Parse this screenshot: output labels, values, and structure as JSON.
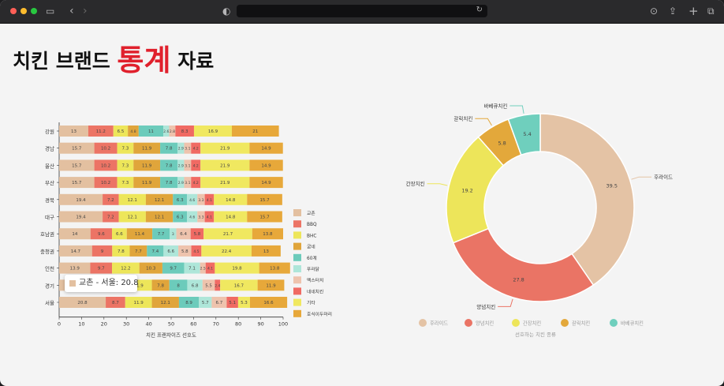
{
  "browser": {
    "url": ""
  },
  "page": {
    "title_a": "치킨 브랜드 ",
    "title_b": "통계",
    "title_c": " 자료"
  },
  "colors": {
    "교촌": "#e3c0a0",
    "BBQ": "#ec7465",
    "BHC": "#ede65a",
    "굽네": "#e0a53b",
    "60계": "#6ccbbb",
    "푸라닭": "#aee6d9",
    "멕스터치": "#eec3ad",
    "네네치킨": "#f06a63",
    "기타": "#f0e860",
    "호식이두마리": "#e7a83a",
    "후라이드": "#e4c3a5",
    "양념치킨": "#ea7465",
    "간장치킨": "#ede55a",
    "갈릭치킨": "#e3a83b",
    "바베큐치킨": "#6fcfbd"
  },
  "chart_data": [
    {
      "type": "bar",
      "orientation": "horizontal-stacked",
      "categories": [
        "강원",
        "경남",
        "울산",
        "부산",
        "경북",
        "대구",
        "호남권",
        "충청권",
        "인천",
        "경기",
        "서울"
      ],
      "series": [
        {
          "name": "교촌",
          "values": [
            13,
            15.7,
            15.7,
            15.7,
            19.4,
            19.4,
            14,
            14.7,
            13.9,
            20.8,
            20.8
          ]
        },
        {
          "name": "BBQ",
          "values": [
            11.2,
            10.2,
            10.2,
            10.2,
            7.2,
            7.2,
            9.6,
            9.0,
            9.7,
            8.7,
            8.7
          ]
        },
        {
          "name": "BHC",
          "values": [
            6.5,
            7.3,
            7.3,
            7.3,
            12.1,
            12.1,
            6.6,
            7.8,
            12.2,
            11.9,
            11.9
          ]
        },
        {
          "name": "굽네",
          "values": [
            4.8,
            11.9,
            11.9,
            11.9,
            12.1,
            12.1,
            11.4,
            7.7,
            10.3,
            7.8,
            12.1
          ]
        },
        {
          "name": "60계",
          "values": [
            11,
            7.8,
            7.8,
            7.8,
            6.3,
            6.3,
            7.7,
            7.4,
            9.7,
            8,
            8.9
          ]
        },
        {
          "name": "푸라닭",
          "values": [
            2.6,
            2.9,
            2.9,
            2.9,
            4.6,
            4.6,
            3,
            6.6,
            7.1,
            6.8,
            5.7
          ]
        },
        {
          "name": "멕스터치",
          "values": [
            2.8,
            3.1,
            3.1,
            3.1,
            3.3,
            3.3,
            6.4,
            5.8,
            2.5,
            5.5,
            6.7
          ]
        },
        {
          "name": "네네치킨",
          "values": [
            8.3,
            4.2,
            4.2,
            4.2,
            4.1,
            4.1,
            5.8,
            4.5,
            4.1,
            2.4,
            5.1
          ]
        },
        {
          "name": "기타",
          "values": [
            16.9,
            21.9,
            21.9,
            21.9,
            14.8,
            14.8,
            21.7,
            22.4,
            19.8,
            16.7,
            5.3
          ]
        },
        {
          "name": "호식이두마리",
          "values": [
            21,
            14.9,
            14.9,
            14.9,
            15.7,
            15.7,
            13.8,
            13,
            13.8,
            11.9,
            16.6
          ]
        }
      ],
      "legend_labels": [
        "교촌",
        "BBQ",
        "BHC",
        "굽네",
        "60계",
        "푸라닭",
        "멕스터치",
        "네네치킨",
        "기타",
        "호식이두마리"
      ],
      "xticks": [
        "0",
        "10",
        "20",
        "30",
        "40",
        "50",
        "60",
        "70",
        "80",
        "90",
        "100"
      ],
      "xlim": [
        0,
        100
      ],
      "xlabel": "치킨 프랜차이즈 선호도",
      "legend_position": "right",
      "tooltip": {
        "text": "교촌 - 서울: 20.8",
        "series": "교촌"
      }
    },
    {
      "type": "pie",
      "variant": "donut",
      "labels": [
        "후라이드",
        "양념치킨",
        "간장치킨",
        "갈릭치킨",
        "바베큐치킨"
      ],
      "values": [
        39.5,
        27.8,
        19.2,
        5.8,
        5.4
      ],
      "value_labels": [
        "39.5",
        "27.8",
        "19.2",
        "5.8",
        "5.4"
      ],
      "xlabel": "선호하는 치킨 종류",
      "legend_position": "bottom"
    }
  ]
}
